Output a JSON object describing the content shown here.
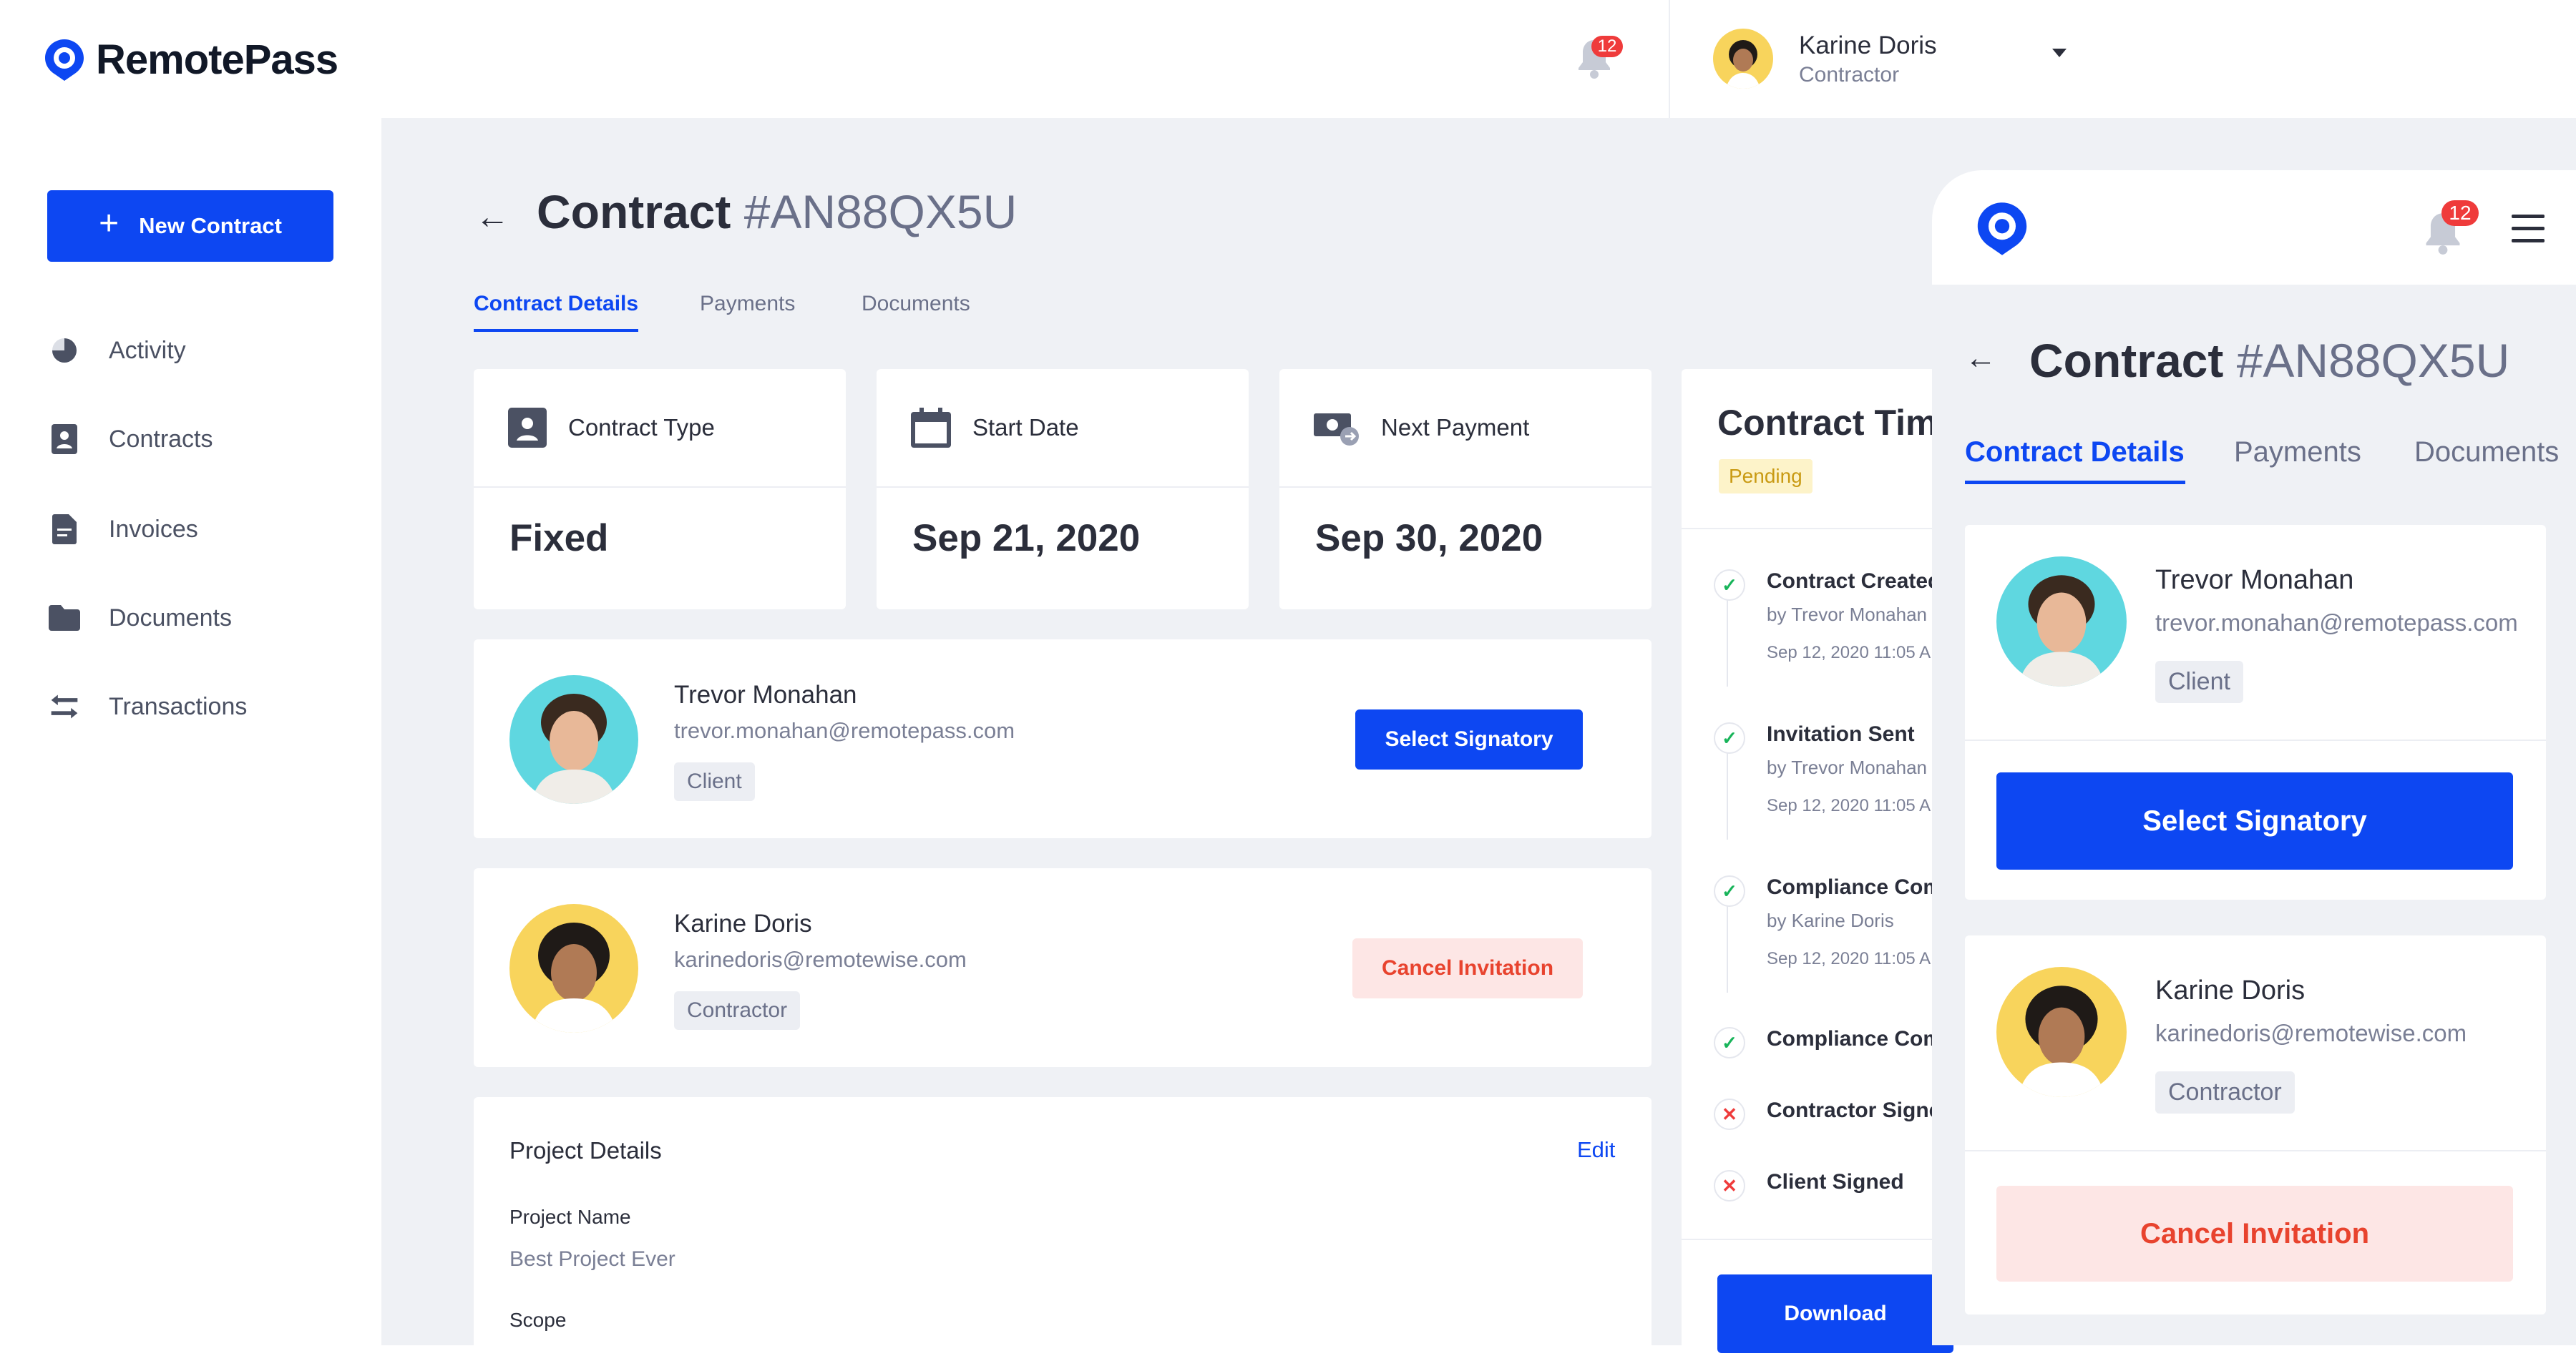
{
  "brand": {
    "name": "RemotePass",
    "accent": "#0d47f2"
  },
  "header": {
    "notification_count": "12",
    "user": {
      "name": "Karine Doris",
      "role": "Contractor"
    }
  },
  "sidebar": {
    "new_contract_label": "New Contract",
    "items": [
      {
        "label": "Activity",
        "icon": "pie-chart-icon"
      },
      {
        "label": "Contracts",
        "icon": "contract-icon"
      },
      {
        "label": "Invoices",
        "icon": "invoice-icon"
      },
      {
        "label": "Documents",
        "icon": "folder-icon"
      },
      {
        "label": "Transactions",
        "icon": "transfer-arrows-icon"
      }
    ]
  },
  "contract": {
    "title": "Contract",
    "number": "#AN88QX5U",
    "tabs": [
      "Contract Details",
      "Payments",
      "Documents"
    ],
    "active_tab": "Contract Details",
    "summary": [
      {
        "label": "Contract Type",
        "value": "Fixed",
        "icon": "contract-icon"
      },
      {
        "label": "Start Date",
        "value": "Sep 21, 2020",
        "icon": "calendar-icon"
      },
      {
        "label": "Next Payment",
        "value": "Sep 30, 2020",
        "icon": "money-icon"
      }
    ],
    "client": {
      "name": "Trevor Monahan",
      "email": "trevor.monahan@remotepass.com",
      "role": "Client",
      "action": "Select Signatory"
    },
    "contractor": {
      "name": "Karine Doris",
      "email": "karinedoris@remotewise.com",
      "role": "Contractor",
      "action": "Cancel Invitation"
    },
    "project": {
      "heading": "Project Details",
      "edit_label": "Edit",
      "name_label": "Project Name",
      "name_value": "Best Project Ever",
      "scope_label": "Scope"
    },
    "timeline": {
      "title": "Contract Tim",
      "status": "Pending",
      "events": [
        {
          "title": "Contract Created",
          "by": "by Trevor Monahan",
          "date": "Sep 12, 2020 11:05 A",
          "state": "done"
        },
        {
          "title": "Invitation Sent",
          "by": "by Trevor Monahan",
          "date": "Sep 12, 2020 11:05 A",
          "state": "done"
        },
        {
          "title": "Compliance Com",
          "by": "by Karine Doris",
          "date": "Sep 12, 2020 11:05 A",
          "state": "done"
        },
        {
          "title": "Compliance Com",
          "by": "",
          "date": "",
          "state": "done"
        },
        {
          "title": "Contractor Signe",
          "by": "",
          "date": "",
          "state": "pending"
        },
        {
          "title": "Client Signed",
          "by": "",
          "date": "",
          "state": "pending"
        }
      ],
      "download_label": "Download"
    }
  },
  "mobile": {
    "notification_count": "12",
    "title": "Contract",
    "number": "#AN88QX5U",
    "tabs": [
      "Contract Details",
      "Payments",
      "Documents"
    ]
  },
  "colors": {
    "primary": "#0d47f2",
    "danger": "#e8432e",
    "danger_bg": "#fde6e5",
    "pending_bg": "#fdf3c9",
    "pending_text": "#c99a13",
    "success": "#18b45a"
  }
}
